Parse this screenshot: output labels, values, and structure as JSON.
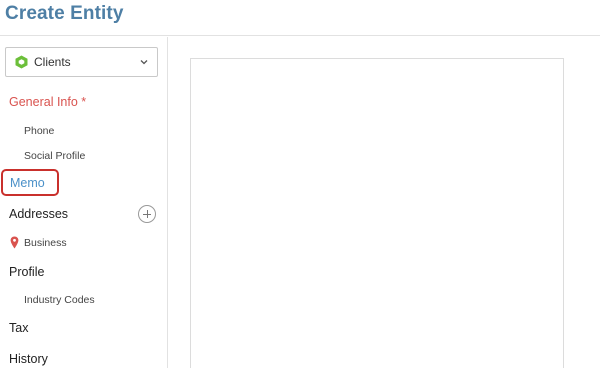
{
  "header": {
    "title": "Create Entity"
  },
  "entity_select": {
    "selected": "Clients",
    "icon": "hexagon-icon",
    "icon_color": "#6cbf3a"
  },
  "sidebar": {
    "general_info": "General Info",
    "required_marker": "*",
    "phone": "Phone",
    "social_profile": "Social Profile",
    "memo": "Memo",
    "addresses": "Addresses",
    "business": "Business",
    "profile": "Profile",
    "industry_codes": "Industry Codes",
    "tax": "Tax",
    "history": "History"
  },
  "colors": {
    "title": "#4e7fa5",
    "required": "#d9534f",
    "active_link": "#4a90c8",
    "highlight_border": "#c9302c",
    "pin": "#d9534f"
  }
}
